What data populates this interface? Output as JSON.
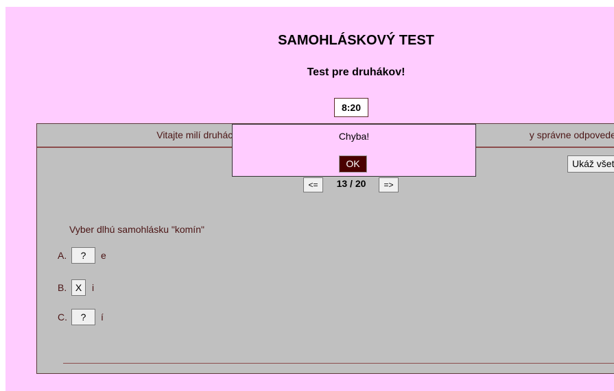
{
  "header": {
    "title": "SAMOHLÁSKOVÝ TEST",
    "subtitle": "Test pre druhákov!",
    "timer": "8:20"
  },
  "panel": {
    "welcome_text": "Vitajte milí druháci. Po                                                                                                        y správne odpovede.",
    "show_all_label": "Ukáž všetk",
    "prev_label": "<=",
    "next_label": "=>",
    "counter": "13 / 20"
  },
  "question": {
    "text": "Vyber dlhú samohlásku \"komín\"",
    "options": [
      {
        "letter": "A.",
        "button": "?",
        "text": "e"
      },
      {
        "letter": "B.",
        "button": "X",
        "text": "i"
      },
      {
        "letter": "C.",
        "button": "?",
        "text": "í"
      }
    ]
  },
  "dialog": {
    "message": "Chyba!",
    "ok_label": "OK"
  },
  "colors": {
    "page_bg": "#ffccff",
    "panel_bg": "#c0c0c0",
    "text_brown": "#4b1515",
    "ok_bg": "#4a0000"
  }
}
